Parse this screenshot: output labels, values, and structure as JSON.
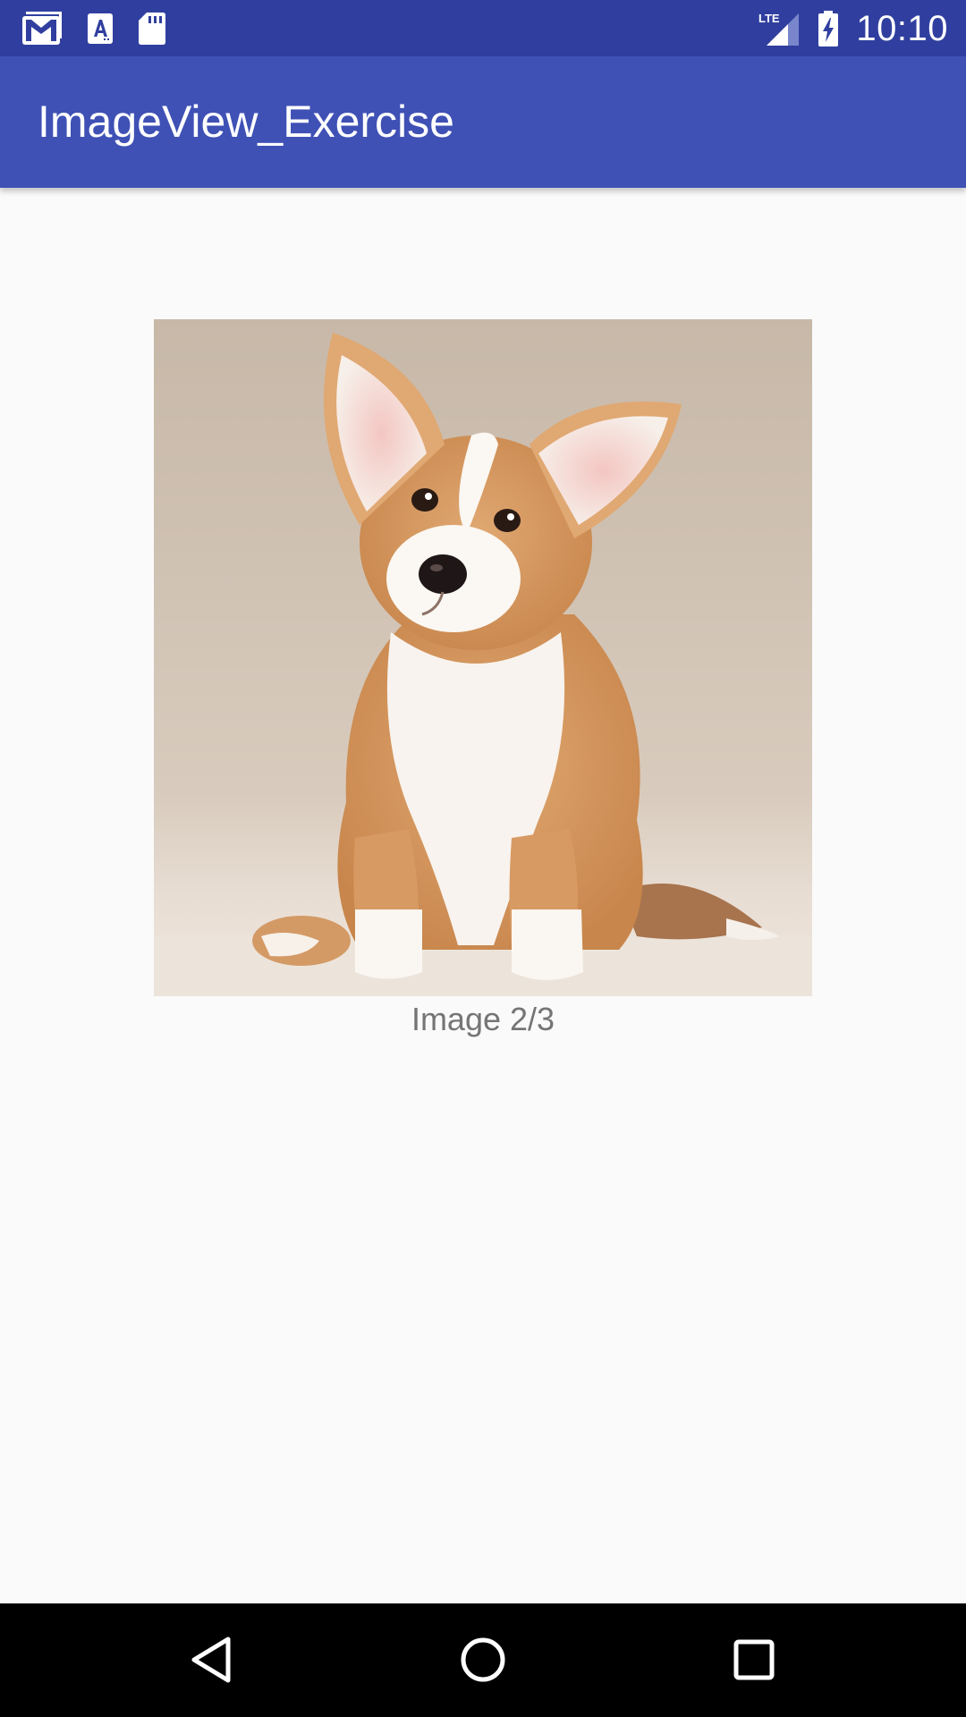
{
  "status_bar": {
    "time": "10:10",
    "network_label": "LTE",
    "icons": [
      "gmail-icon",
      "font-a-icon",
      "sd-card-icon",
      "lte-signal-icon",
      "battery-charging-icon"
    ]
  },
  "app_bar": {
    "title": "ImageView_Exercise"
  },
  "main": {
    "image": {
      "subject": "corgi puppy sitting on a beige studio background",
      "position": 2,
      "total": 3
    },
    "caption": "Image 2/3"
  },
  "nav_bar": {
    "buttons": [
      "back-icon",
      "home-icon",
      "recents-icon"
    ]
  },
  "colors": {
    "status_bar": "#303f9f",
    "app_bar": "#3f51b5",
    "background": "#fafafa",
    "caption_text": "#757575",
    "nav_bar": "#000000"
  }
}
